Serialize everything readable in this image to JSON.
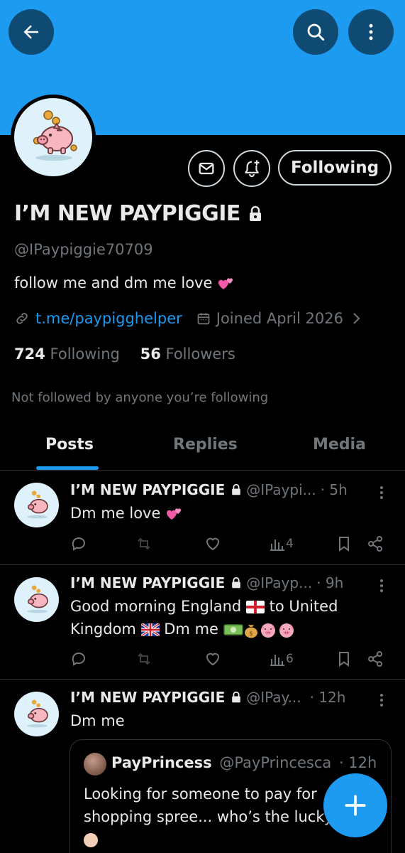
{
  "profile": {
    "display_name": "I’M NEW PAYPIGGIE",
    "handle": "@IPaypiggie70709",
    "bio": "follow me and dm me love",
    "link": "t.me/paypigghelper",
    "joined": "Joined April 2026",
    "following_count": "724",
    "following_label": "Following",
    "followers_count": "56",
    "followers_label": "Followers",
    "not_followed": "Not followed by anyone you’re following",
    "following_button": "Following"
  },
  "tabs": [
    {
      "label": "Posts",
      "active": true
    },
    {
      "label": "Replies",
      "active": false
    },
    {
      "label": "Media",
      "active": false
    }
  ],
  "posts": [
    {
      "name": "I’M NEW PAYPIGGIE",
      "handle": "@IPaypi...",
      "time": "· 5h",
      "text": "Dm me love",
      "views": "4"
    },
    {
      "name": "I’M NEW PAYPIGGIE",
      "handle": "@IPayp...",
      "time": "· 9h",
      "text_line1": "Good morning England",
      "text_line1b": "to United",
      "text_line2": "Kingdom",
      "text_line2b": "Dm me",
      "views": "6"
    },
    {
      "name": "I’M NEW PAYPIGGIE",
      "handle": "@IPay...",
      "time": "· 12h",
      "text": "Dm me",
      "quote": {
        "name": "PayPrincess",
        "handle": "@PayPrincesca",
        "time": "· 12h",
        "text_line1": "Looking for someone to pay for",
        "text_line2": "shopping spree... who’s the lucky"
      }
    }
  ],
  "colors": {
    "accent": "#1d9bf0",
    "banner": "#1d9bf0",
    "background": "#000000",
    "muted": "#71767b"
  }
}
